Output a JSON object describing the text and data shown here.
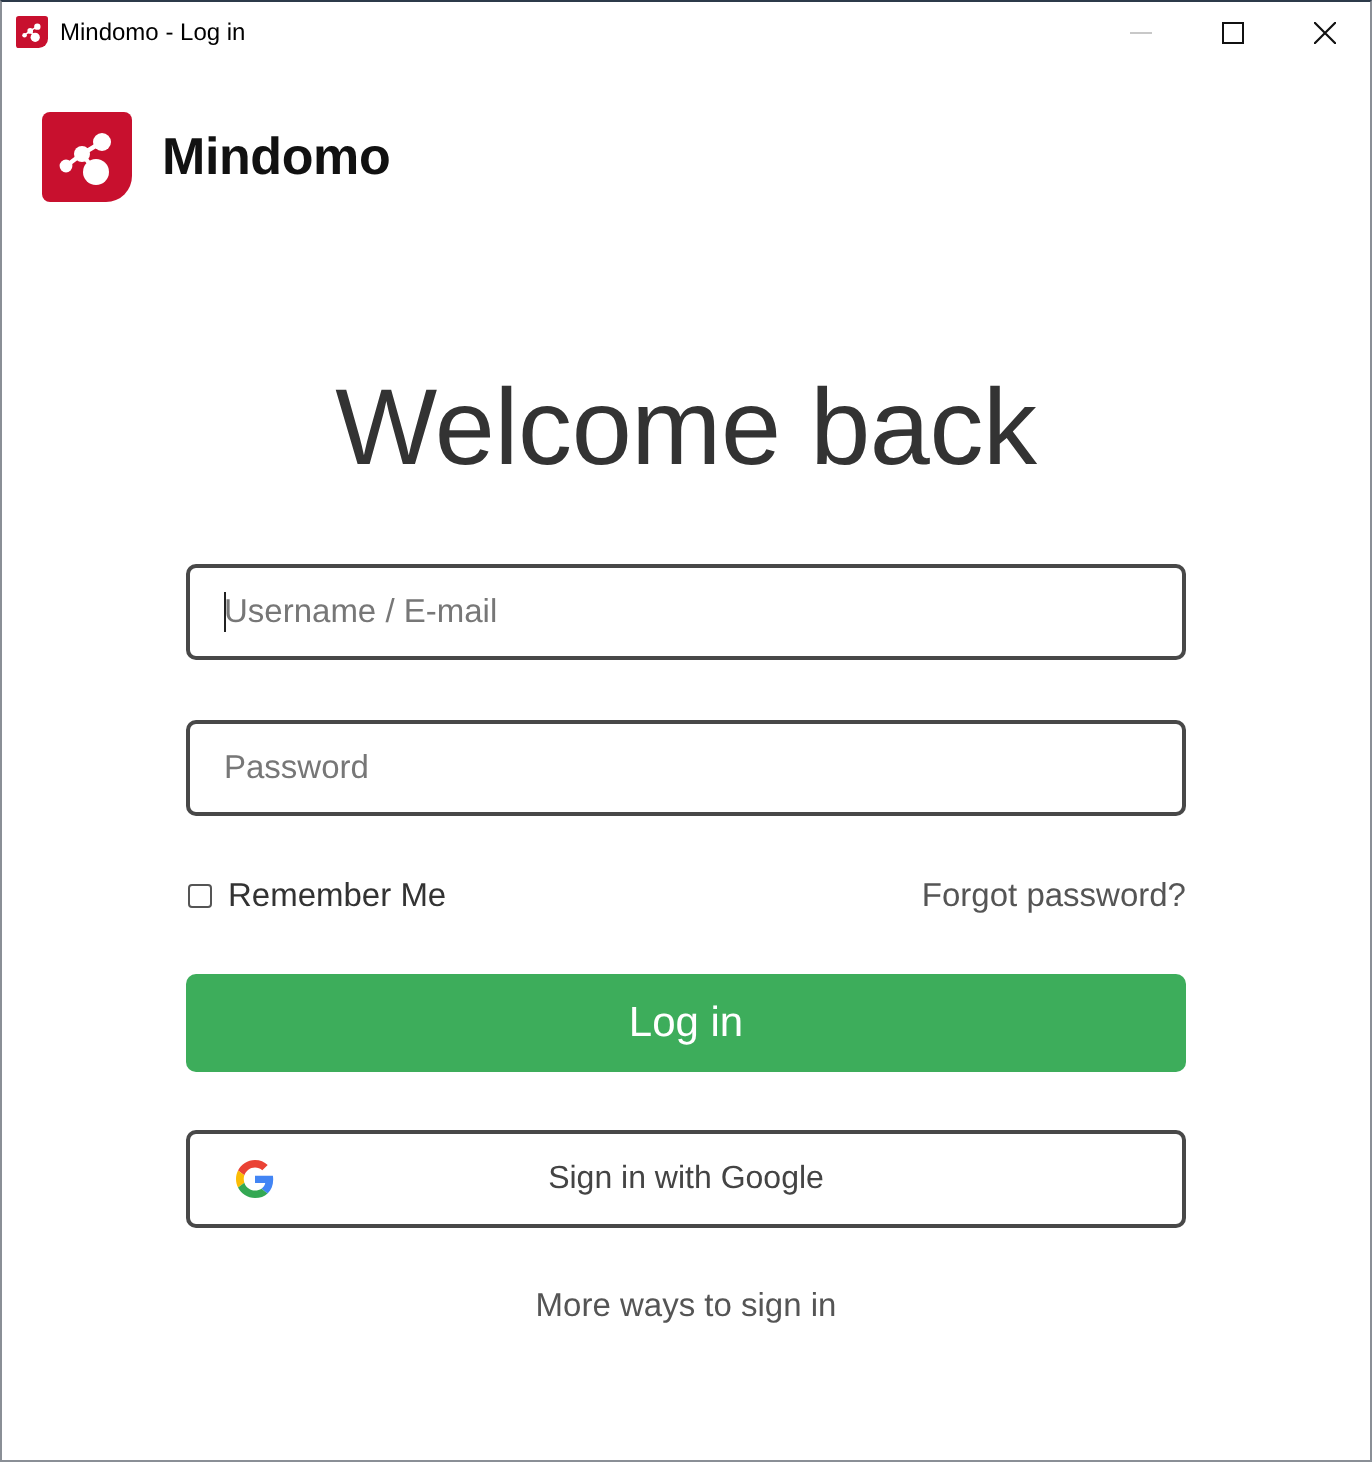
{
  "window": {
    "title": "Mindomo - Log in",
    "minimize": {
      "disabled": true
    }
  },
  "brand": {
    "name": "Mindomo"
  },
  "heading": "Welcome back",
  "fields": [
    {
      "placeholder": "Username / E-mail",
      "focused": true
    },
    {
      "placeholder": "Password",
      "focused": false
    }
  ],
  "remember": {
    "label": "Remember Me",
    "checked": false
  },
  "forgot_link": "Forgot password?",
  "login_button": "Log in",
  "google_button": "Sign in with Google",
  "more_link": "More ways to sign in"
}
